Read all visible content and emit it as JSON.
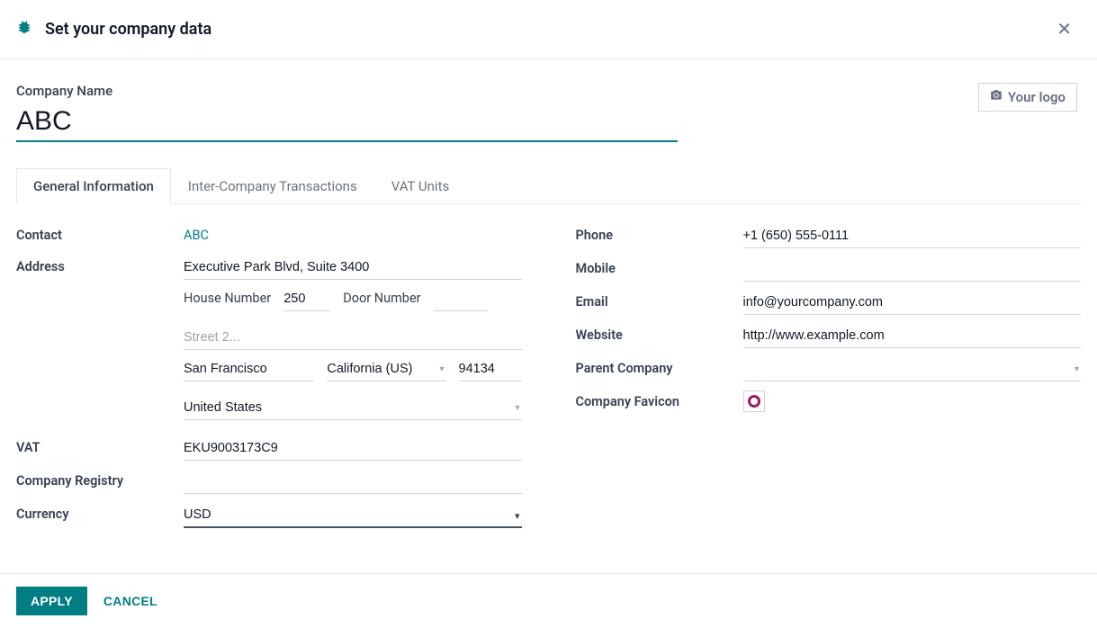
{
  "header": {
    "title": "Set your company data",
    "logo_button": "Your logo"
  },
  "company_name": {
    "label": "Company Name",
    "value": "ABC"
  },
  "tabs": [
    {
      "label": "General Information",
      "active": true
    },
    {
      "label": "Inter-Company Transactions",
      "active": false
    },
    {
      "label": "VAT Units",
      "active": false
    }
  ],
  "labels": {
    "contact": "Contact",
    "address": "Address",
    "house_number": "House Number",
    "door_number": "Door Number",
    "vat": "VAT",
    "company_registry": "Company Registry",
    "currency": "Currency",
    "phone": "Phone",
    "mobile": "Mobile",
    "email": "Email",
    "website": "Website",
    "parent_company": "Parent Company",
    "company_favicon": "Company Favicon"
  },
  "values": {
    "contact": "ABC",
    "street": "Executive Park Blvd, Suite 3400",
    "house_number": "250",
    "door_number": "",
    "street2": "",
    "street2_placeholder": "Street 2...",
    "city": "San Francisco",
    "state": "California (US)",
    "zip": "94134",
    "country": "United States",
    "vat": "EKU9003173C9",
    "company_registry": "",
    "currency": "USD",
    "phone": "+1 (650) 555-0111",
    "mobile": "",
    "email": "info@yourcompany.com",
    "website": "http://www.example.com",
    "parent_company": ""
  },
  "footer": {
    "apply": "APPLY",
    "cancel": "CANCEL"
  }
}
